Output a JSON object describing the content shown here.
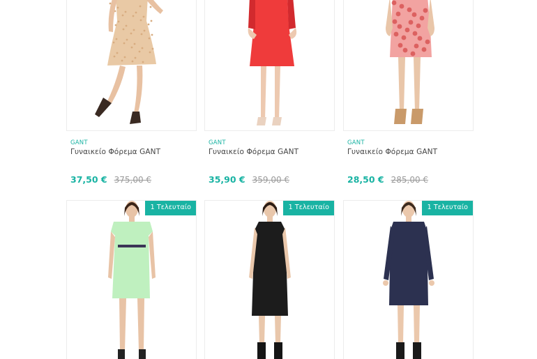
{
  "products": [
    {
      "brand": "GANT",
      "title": "Γυναικείο Φόρεμα GANT",
      "price": "37,50 €",
      "old_price": "375,00 €",
      "colors": {
        "dress": "#e9c9a5",
        "pattern": "#d8ac80",
        "skin": "#e8c1a2",
        "shoes": "#3a2a22"
      }
    },
    {
      "brand": "GANT",
      "title": "Γυναικείο Φόρεμα GANT",
      "price": "35,90 €",
      "old_price": "359,00 €",
      "colors": {
        "dress": "#ef3b3b",
        "pattern": "#d22a2e",
        "skin": "#edc9b0",
        "shoes": "#ead2c0"
      }
    },
    {
      "brand": "GANT",
      "title": "Γυναικείο Φόρεμα GANT",
      "price": "28,50 €",
      "old_price": "285,00 €",
      "colors": {
        "dress": "#f2a3a1",
        "pattern": "#d44b4b",
        "skin": "#e9c6a9",
        "shoes": "#c99a6a"
      }
    },
    {
      "badge": "1 Τελευταίο",
      "colors": {
        "dress": "#bff0bf",
        "belt": "#3b3556",
        "skin": "#e8c3a6",
        "hair": "#3a2418",
        "shoes": "#222222"
      }
    },
    {
      "badge": "1 Τελευταίο",
      "colors": {
        "dress": "#1c1c1c",
        "belt": "#1c1c1c",
        "skin": "#e9c7ab",
        "hair": "#2b1c14",
        "shoes": "#151515"
      }
    },
    {
      "badge": "1 Τελευταίο",
      "colors": {
        "dress": "#2c3150",
        "belt": "#2c3150",
        "skin": "#ebc8ac",
        "hair": "#3c2a1e",
        "shoes": "#1a1a1a"
      }
    }
  ],
  "accent_color": "#19b3a3"
}
